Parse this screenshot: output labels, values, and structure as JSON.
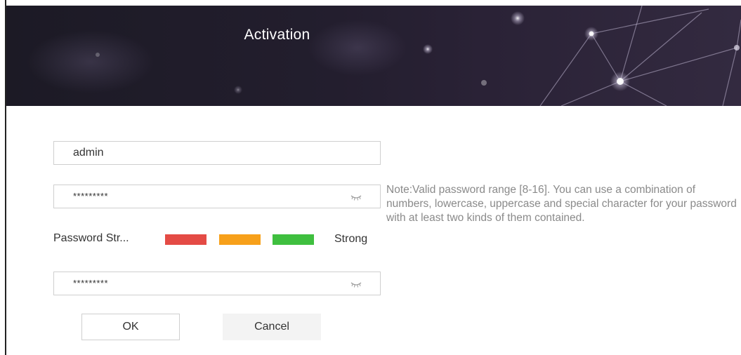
{
  "dialog": {
    "title": "Activation"
  },
  "form": {
    "username_value": "admin",
    "password_mask": "*********",
    "confirm_mask": "*********",
    "strength_label": "Password Str...",
    "strength_level": "Strong",
    "strength_colors": [
      "#e44b45",
      "#f7a01a",
      "#3fbf3f"
    ]
  },
  "note": "Note:Valid password range [8-16]. You can use a combination of numbers, lowercase, uppercase and special character for your password with at least two kinds of them contained.",
  "buttons": {
    "ok_label": "OK",
    "cancel_label": "Cancel"
  },
  "icons": [
    "eye-closed-icon"
  ]
}
